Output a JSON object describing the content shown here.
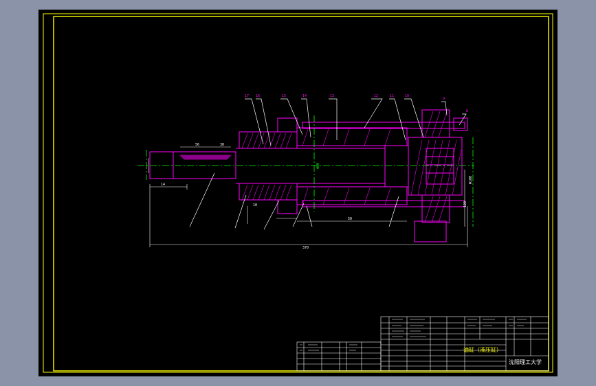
{
  "colors": {
    "backdrop": "#8a93a8",
    "paper": "#000000",
    "frame": "#ffff00",
    "part": "#ff00ff",
    "hatch": "#ff00ff",
    "leader": "#ffffff",
    "center": "#00ff00",
    "dimension": "#ffffff",
    "table_text": "#ffff00"
  },
  "balloons": [
    "17",
    "16",
    "15",
    "14",
    "13",
    "12",
    "11",
    "10",
    "9",
    "8"
  ],
  "dimensions": [
    "56",
    "30",
    "14",
    "370",
    "10",
    "50",
    "Φ80",
    "120",
    "Φ100"
  ],
  "title_block": {
    "school": "沈阳理工大学",
    "drawing_title": "油缸（液压缸）"
  }
}
